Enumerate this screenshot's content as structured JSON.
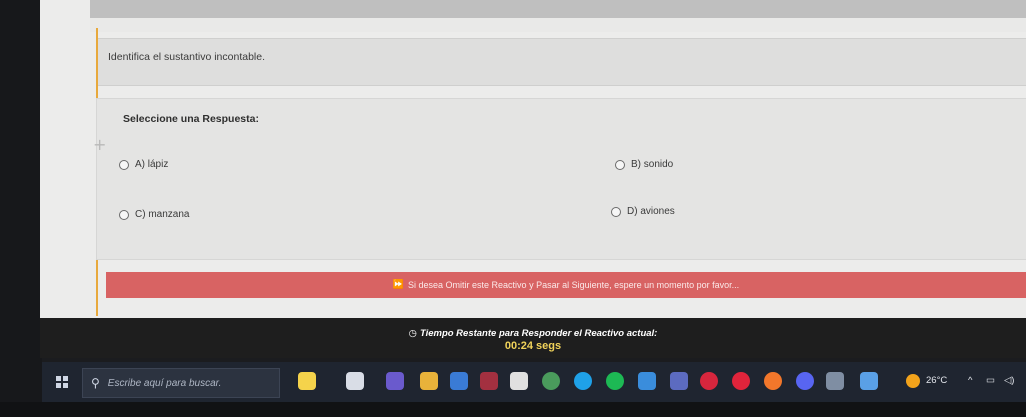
{
  "question": {
    "text": "Identifica el sustantivo incontable."
  },
  "answers": {
    "title": "Seleccione una Respuesta:",
    "options": [
      {
        "label": "A) lápiz"
      },
      {
        "label": "B) sonido"
      },
      {
        "label": "C) manzana"
      },
      {
        "label": "D) aviones"
      }
    ]
  },
  "skip_bar": {
    "icon": "fast-forward-icon",
    "text": "Si desea Omitir este Reactivo y Pasar al Siguiente, espere un momento por favor..."
  },
  "timer": {
    "icon": "clock-icon",
    "label": "Tiempo Restante para Responder el Reactivo actual:",
    "value": "00:24 segs"
  },
  "taskbar": {
    "search_placeholder": "Escribe aquí para buscar.",
    "weather_temp": "26°C",
    "icons": [
      "copilot-icon",
      "task-view-icon",
      "teams-icon",
      "file-explorer-icon",
      "calculator-icon",
      "mail-icon",
      "epic-games-icon",
      "chrome-icon",
      "edge-icon",
      "spotify-icon",
      "vscode-icon",
      "terminal-icon",
      "opera-gx-icon",
      "opera-icon",
      "firefox-icon",
      "discord-icon",
      "steam-icon",
      "app-icon"
    ],
    "icon_colors": [
      "#f5d34b",
      "#d9dde6",
      "#6a5acd",
      "#e8b23a",
      "#3a7bd5",
      "#a33040",
      "#e0e0e0",
      "#4a9b5c",
      "#1fa1e8",
      "#1db954",
      "#3a8ddc",
      "#5c6bc0",
      "#d7263d",
      "#e0243b",
      "#f2772b",
      "#5865f2",
      "#7f8ea3",
      "#5aa0e6"
    ]
  }
}
